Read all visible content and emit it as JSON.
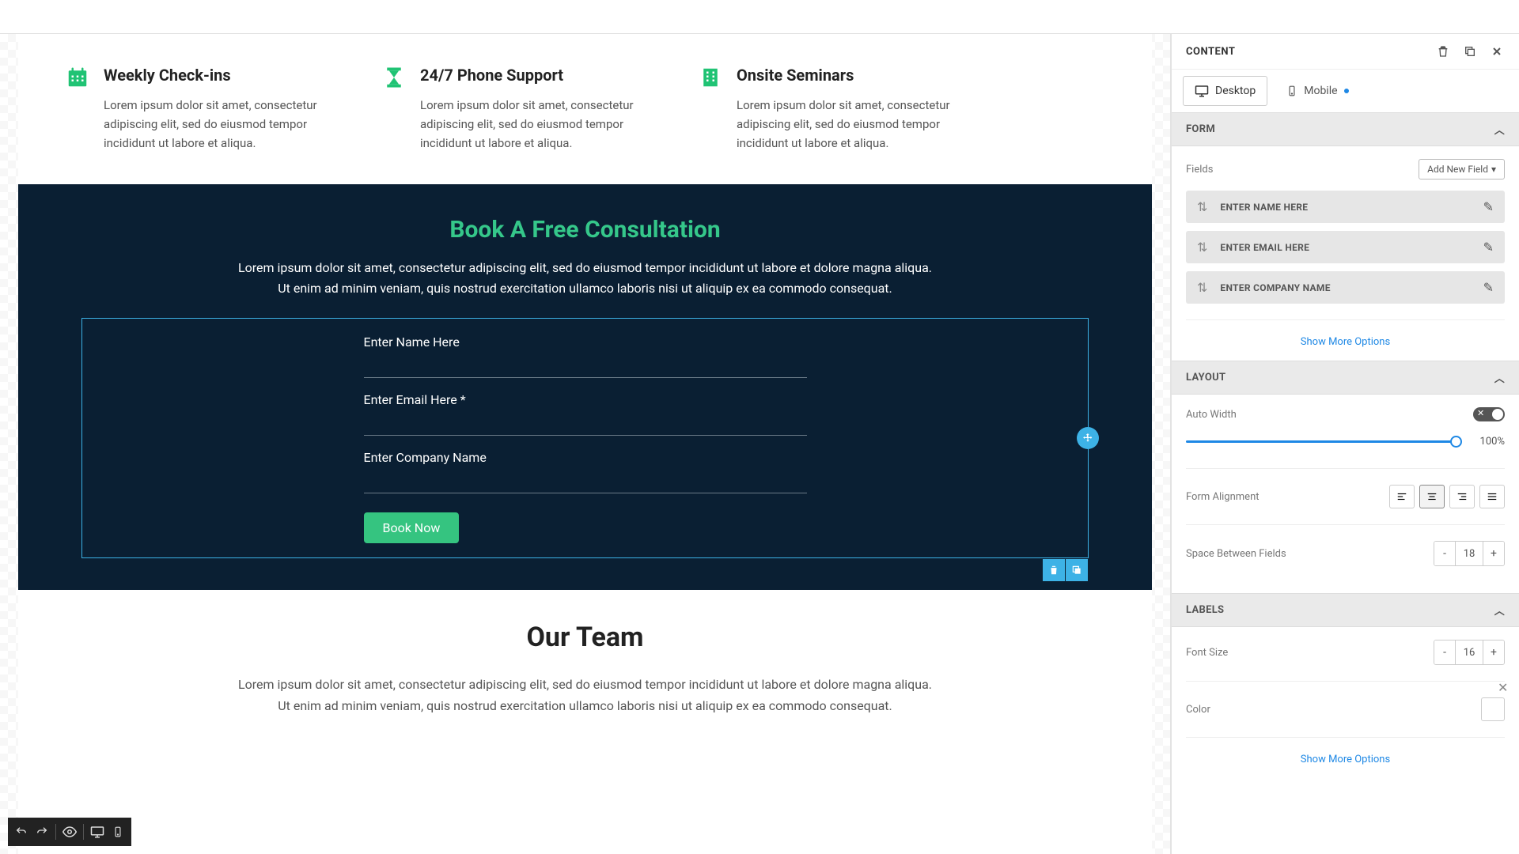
{
  "features": [
    {
      "title": "Weekly Check-ins",
      "desc": "Lorem ipsum dolor sit amet, consectetur adipiscing elit, sed do eiusmod tempor incididunt ut labore et aliqua."
    },
    {
      "title": "24/7 Phone Support",
      "desc": "Lorem ipsum dolor sit amet, consectetur adipiscing elit, sed do eiusmod tempor incididunt ut labore et aliqua."
    },
    {
      "title": "Onsite Seminars",
      "desc": "Lorem ipsum dolor sit amet, consectetur adipiscing elit, sed do eiusmod tempor incididunt ut labore et aliqua."
    }
  ],
  "book": {
    "title": "Book A Free Consultation",
    "desc": "Lorem ipsum dolor sit amet, consectetur adipiscing elit, sed do eiusmod tempor incididunt ut labore et dolore magna aliqua. Ut enim ad minim veniam, quis nostrud exercitation ullamco laboris nisi ut aliquip ex ea commodo consequat.",
    "fields": {
      "name": "Enter Name Here",
      "email": "Enter Email Here *",
      "company": "Enter Company Name"
    },
    "button": "Book Now"
  },
  "team": {
    "title": "Our Team",
    "desc": "Lorem ipsum dolor sit amet, consectetur adipiscing elit, sed do eiusmod tempor incididunt ut labore et dolore magna aliqua. Ut enim ad minim veniam, quis nostrud exercitation ullamco laboris nisi ut aliquip ex ea commodo consequat."
  },
  "sidebar": {
    "title": "CONTENT",
    "tabs": {
      "desktop": "Desktop",
      "mobile": "Mobile"
    },
    "form": {
      "header": "FORM",
      "fieldsLabel": "Fields",
      "addField": "Add New Field",
      "items": [
        "ENTER NAME HERE",
        "ENTER EMAIL HERE",
        "ENTER COMPANY NAME"
      ],
      "showMore": "Show More Options"
    },
    "layout": {
      "header": "LAYOUT",
      "autoWidth": "Auto Width",
      "widthValue": "100%",
      "formAlignment": "Form Alignment",
      "spaceBetween": "Space Between Fields",
      "spaceValue": "18"
    },
    "labels": {
      "header": "LABELS",
      "fontSize": "Font Size",
      "fontSizeValue": "16",
      "color": "Color",
      "showMore": "Show More Options"
    }
  }
}
